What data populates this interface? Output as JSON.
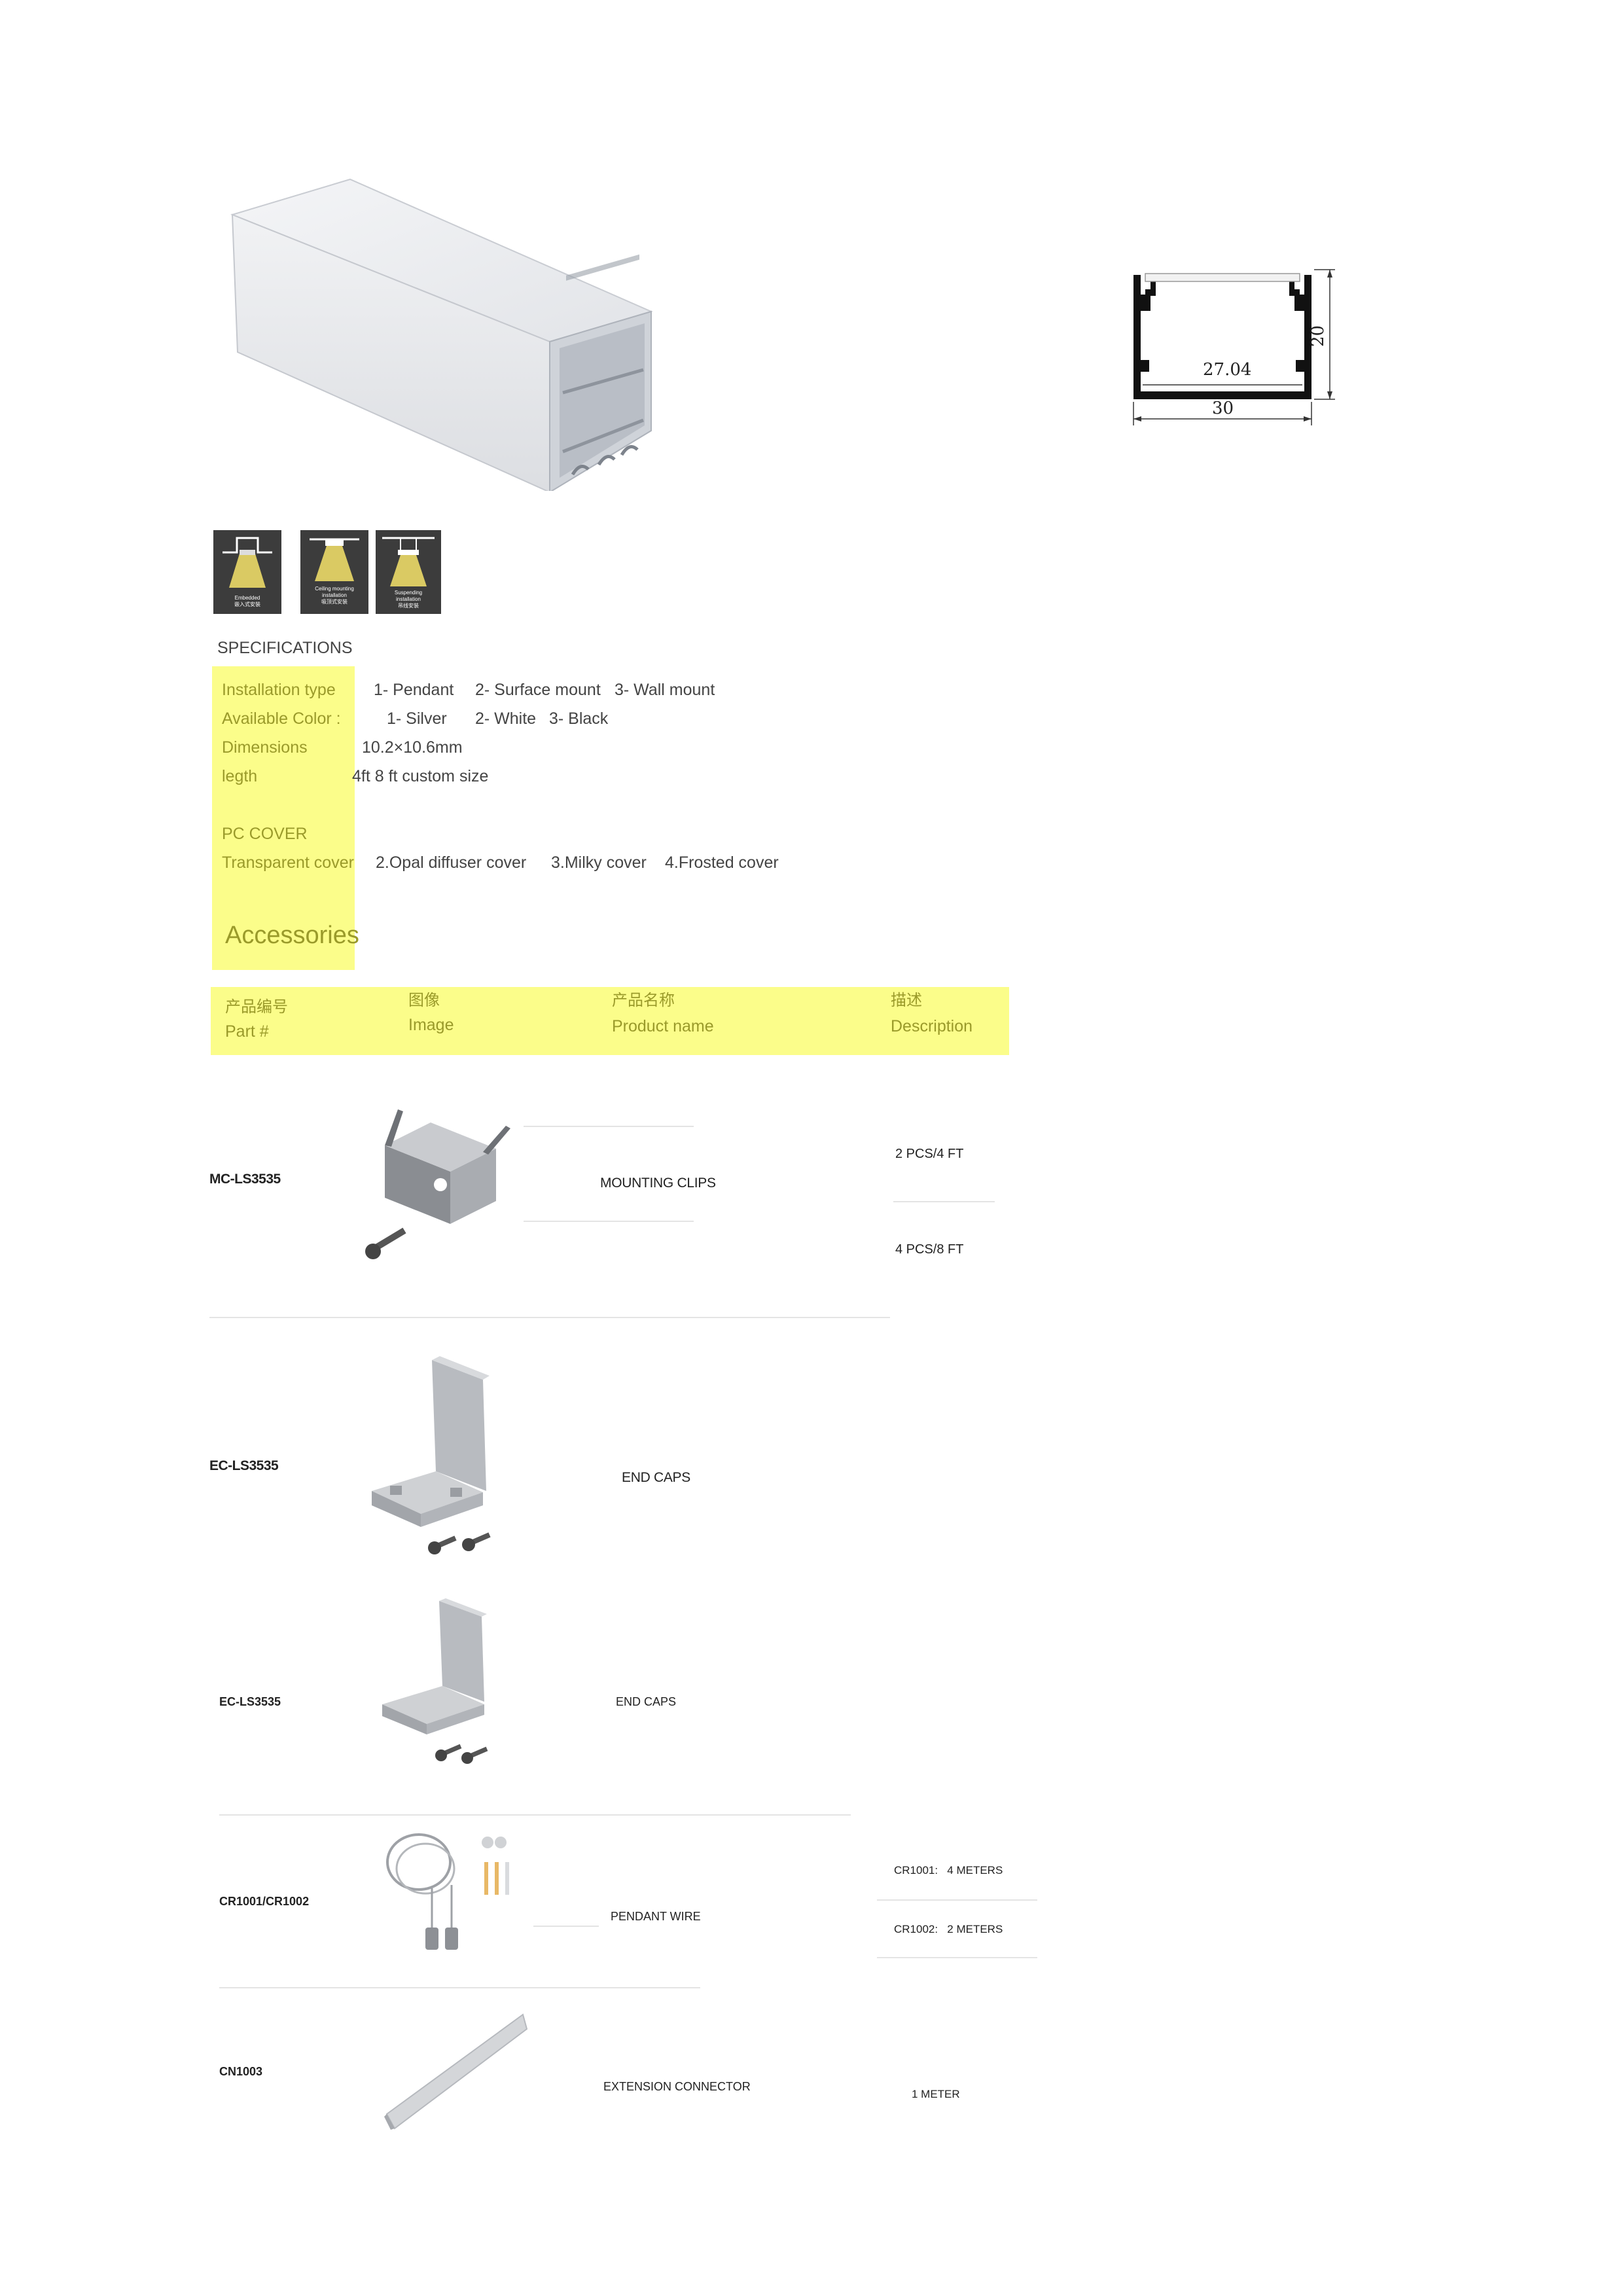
{
  "dimension_drawing": {
    "inner_width": "27.04",
    "outer_width": "30",
    "height": "20"
  },
  "install_icons": [
    {
      "name": "embedded-installation-icon",
      "caption_en": "Embedded installation",
      "caption_cn": "嵌入式安装"
    },
    {
      "name": "ceiling-mounting-installation-icon",
      "caption_en": "Ceiling mounting installation",
      "caption_cn": "吸顶式安装"
    },
    {
      "name": "suspending-installation-icon",
      "caption_en": "Suspending installation",
      "caption_cn": "吊线安装"
    }
  ],
  "specs": {
    "heading": "SPECIFICATIONS",
    "install_label": "Installation type",
    "install_values": [
      "1- Pendant",
      "2- Surface mount",
      "3- Wall mount"
    ],
    "color_label": "Available Color :",
    "color_values": [
      "1- Silver",
      "2- White",
      "3- Black"
    ],
    "dim_label": "Dimensions",
    "dim_value": "10.2×10.6mm",
    "length_label": "legth",
    "length_value": "4ft  8 ft  custom size",
    "pc_label": "PC COVER",
    "cover_label": "Transparent cover",
    "cover_values": [
      "2.Opal diffuser cover",
      "3.Milky cover",
      "4.Frosted cover"
    ],
    "accessories_title": "Accessories"
  },
  "table_header": {
    "part_cn": "产品编号",
    "part_en": "Part #",
    "image_cn": "图像",
    "image_en": "Image",
    "name_cn": "产品名称",
    "name_en": "Product name",
    "desc_cn": "描述",
    "desc_en": "Description"
  },
  "rows": [
    {
      "part": "MC-LS3535",
      "name": "MOUNTING CLIPS",
      "desc": [
        "2 PCS/4 FT",
        "4 PCS/8 FT"
      ]
    },
    {
      "part": "EC-LS3535",
      "name": "END CAPS",
      "desc": []
    },
    {
      "part": "EC-LS3535",
      "name": "END CAPS",
      "desc": []
    },
    {
      "part": "CR1001/CR1002",
      "name": "PENDANT WIRE",
      "desc": [
        "CR1001:   4 METERS",
        "CR1002:   2 METERS"
      ]
    },
    {
      "part": "CN1003",
      "name": "EXTENSION CONNECTOR",
      "desc": [
        "1 METER"
      ]
    }
  ]
}
